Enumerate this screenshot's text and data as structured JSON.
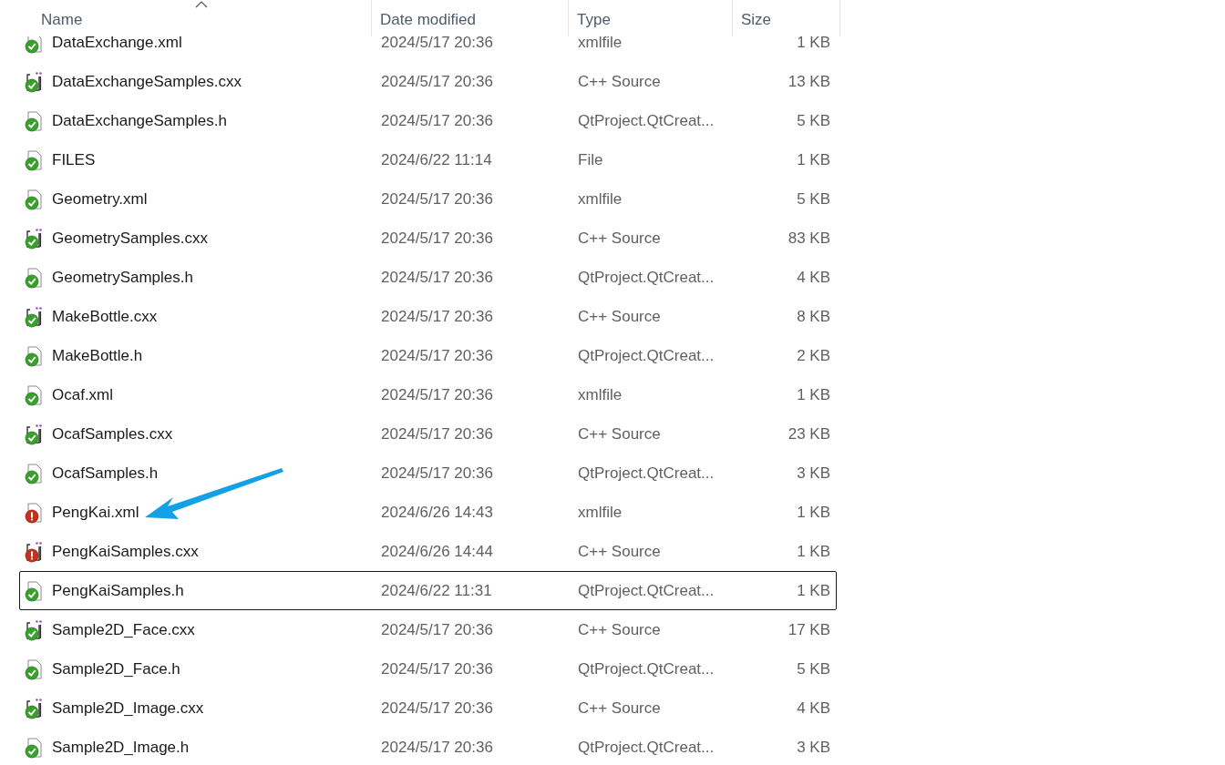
{
  "columns": [
    {
      "label": "Name",
      "sorted": true
    },
    {
      "label": "Date modified",
      "sorted": false
    },
    {
      "label": "Type",
      "sorted": false
    },
    {
      "label": "Size",
      "sorted": false
    }
  ],
  "rows": [
    {
      "name": "DataExchange.xml",
      "date": "2024/5/17 20:36",
      "type": "xmlfile",
      "size": "1 KB",
      "kind": "doc",
      "conflict": false,
      "focused": false
    },
    {
      "name": "DataExchangeSamples.cxx",
      "date": "2024/5/17 20:36",
      "type": "C++ Source",
      "size": "13 KB",
      "kind": "cpp",
      "conflict": false,
      "focused": false
    },
    {
      "name": "DataExchangeSamples.h",
      "date": "2024/5/17 20:36",
      "type": "QtProject.QtCreat...",
      "size": "5 KB",
      "kind": "doc",
      "conflict": false,
      "focused": false
    },
    {
      "name": "FILES",
      "date": "2024/6/22 11:14",
      "type": "File",
      "size": "1 KB",
      "kind": "doc",
      "conflict": false,
      "focused": false
    },
    {
      "name": "Geometry.xml",
      "date": "2024/5/17 20:36",
      "type": "xmlfile",
      "size": "5 KB",
      "kind": "doc",
      "conflict": false,
      "focused": false
    },
    {
      "name": "GeometrySamples.cxx",
      "date": "2024/5/17 20:36",
      "type": "C++ Source",
      "size": "83 KB",
      "kind": "cpp",
      "conflict": false,
      "focused": false
    },
    {
      "name": "GeometrySamples.h",
      "date": "2024/5/17 20:36",
      "type": "QtProject.QtCreat...",
      "size": "4 KB",
      "kind": "doc",
      "conflict": false,
      "focused": false
    },
    {
      "name": "MakeBottle.cxx",
      "date": "2024/5/17 20:36",
      "type": "C++ Source",
      "size": "8 KB",
      "kind": "cpp",
      "conflict": false,
      "focused": false
    },
    {
      "name": "MakeBottle.h",
      "date": "2024/5/17 20:36",
      "type": "QtProject.QtCreat...",
      "size": "2 KB",
      "kind": "doc",
      "conflict": false,
      "focused": false
    },
    {
      "name": "Ocaf.xml",
      "date": "2024/5/17 20:36",
      "type": "xmlfile",
      "size": "1 KB",
      "kind": "doc",
      "conflict": false,
      "focused": false
    },
    {
      "name": "OcafSamples.cxx",
      "date": "2024/5/17 20:36",
      "type": "C++ Source",
      "size": "23 KB",
      "kind": "cpp",
      "conflict": false,
      "focused": false
    },
    {
      "name": "OcafSamples.h",
      "date": "2024/5/17 20:36",
      "type": "QtProject.QtCreat...",
      "size": "3 KB",
      "kind": "doc",
      "conflict": false,
      "focused": false
    },
    {
      "name": "PengKai.xml",
      "date": "2024/6/26 14:43",
      "type": "xmlfile",
      "size": "1 KB",
      "kind": "doc",
      "conflict": true,
      "focused": false
    },
    {
      "name": "PengKaiSamples.cxx",
      "date": "2024/6/26 14:44",
      "type": "C++ Source",
      "size": "1 KB",
      "kind": "cpp",
      "conflict": true,
      "focused": false
    },
    {
      "name": "PengKaiSamples.h",
      "date": "2024/6/22 11:31",
      "type": "QtProject.QtCreat...",
      "size": "1 KB",
      "kind": "doc",
      "conflict": false,
      "focused": true
    },
    {
      "name": "Sample2D_Face.cxx",
      "date": "2024/5/17 20:36",
      "type": "C++ Source",
      "size": "17 KB",
      "kind": "cpp",
      "conflict": false,
      "focused": false
    },
    {
      "name": "Sample2D_Face.h",
      "date": "2024/5/17 20:36",
      "type": "QtProject.QtCreat...",
      "size": "5 KB",
      "kind": "doc",
      "conflict": false,
      "focused": false
    },
    {
      "name": "Sample2D_Image.cxx",
      "date": "2024/5/17 20:36",
      "type": "C++ Source",
      "size": "4 KB",
      "kind": "cpp",
      "conflict": false,
      "focused": false
    },
    {
      "name": "Sample2D_Image.h",
      "date": "2024/5/17 20:36",
      "type": "QtProject.QtCreat...",
      "size": "3 KB",
      "kind": "doc",
      "conflict": false,
      "focused": false
    }
  ]
}
